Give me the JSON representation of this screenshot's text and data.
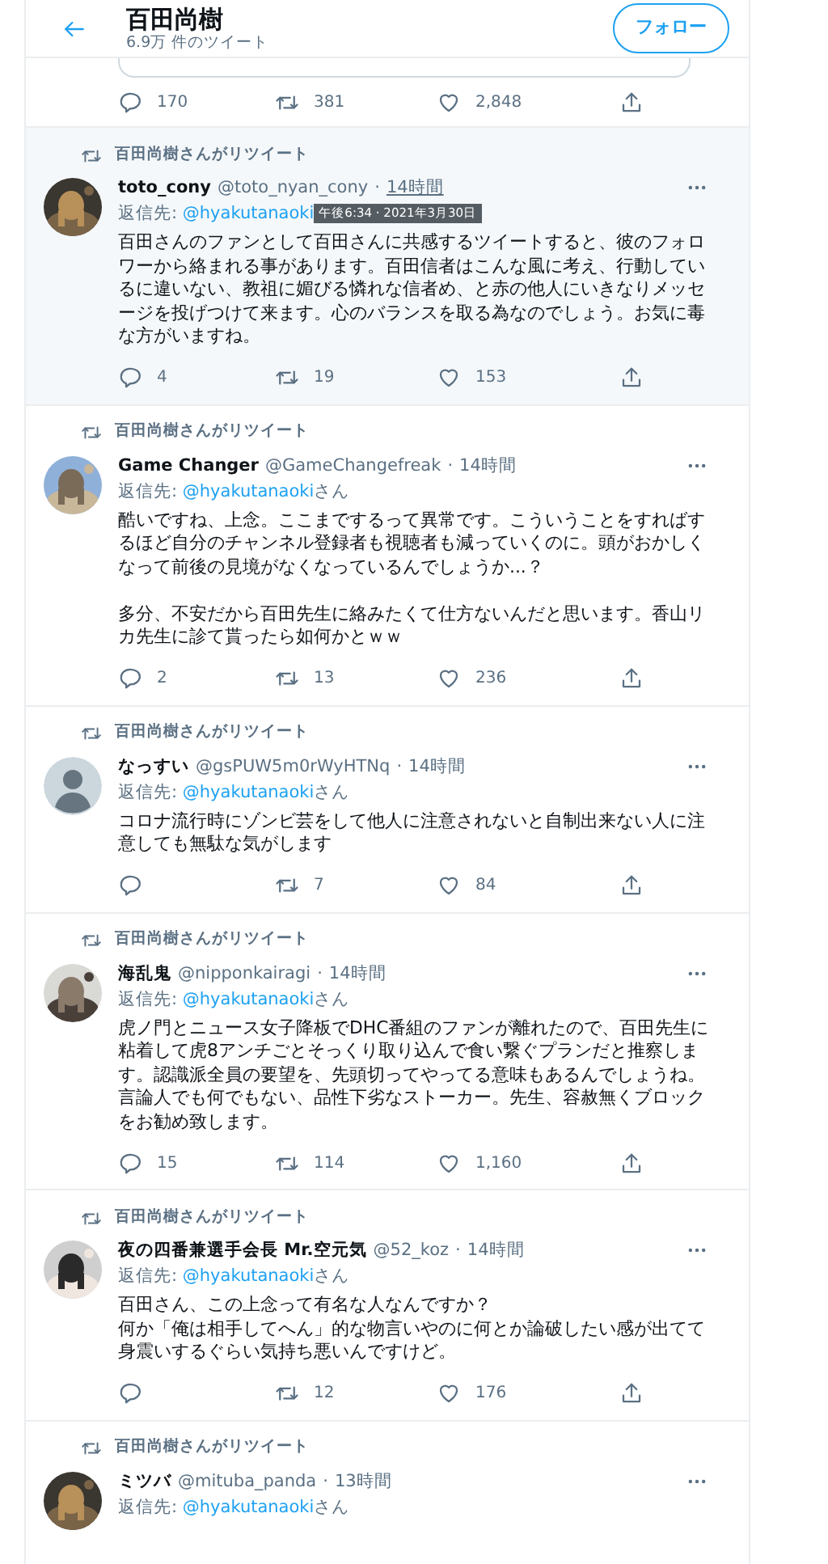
{
  "header": {
    "title": "百田尚樹",
    "subtitle": "6.9万 件のツイート",
    "follow_button": "フォロー"
  },
  "top_actions": {
    "reply": "170",
    "retweet": "381",
    "like": "2,848"
  },
  "tweets": [
    {
      "retweeted_by": "百田尚樹さんがリツイート",
      "avatar": {
        "kind": "picture"
      },
      "name": "toto_cony",
      "handle": "@toto_nyan_cony",
      "separator": "·",
      "time": "14時間",
      "hovered": true,
      "tooltip": "午後6:34 · 2021年3月30日",
      "reply_label": "返信先:",
      "reply_to": "@hyakutanaoki",
      "body": [
        [
          "百田さんのファンとして百田さんに共感するツイートすると、彼のフォロワーから絡まれる事があります。百田信者はこんな風に考え、行動しているに違いない、教祖に媚びる憐れな信者め、と赤の他人にいきなりメッセージを投げつけて来ます。心のバランスを取る為なのでしょう。お気に毒な方がいますね。"
        ]
      ],
      "reply": "4",
      "retweet": "19",
      "like": "153"
    },
    {
      "retweeted_by": "百田尚樹さんがリツイート",
      "avatar": {
        "kind": "picture"
      },
      "name": "Game Changer",
      "handle": "@GameChangefreak",
      "separator": "·",
      "time": "14時間",
      "hovered": false,
      "reply_label": "返信先:",
      "reply_to": "@hyakutanaoki",
      "reply_suffix": "さん",
      "body": [
        [
          "酷いですね、上念。ここまでするって異常です。こういうことをすればするほど自分のチャンネル登録者も視聴者も減っていくのに。頭がおかしくなって前後の見境がなくなっているんでしょうか...？"
        ],
        [
          "多分、不安だから百田先生に絡みたくて仕方ないんだと思います。香山リカ先生に診て貰ったら如何かとｗｗ"
        ]
      ],
      "reply": "2",
      "retweet": "13",
      "like": "236"
    },
    {
      "retweeted_by": "百田尚樹さんがリツイート",
      "avatar": {
        "kind": "default"
      },
      "name": "なっすい",
      "handle": "@gsPUW5m0rWyHTNq",
      "separator": "·",
      "time": "14時間",
      "hovered": false,
      "reply_label": "返信先:",
      "reply_to": "@hyakutanaoki",
      "reply_suffix": "さん",
      "body": [
        [
          "コロナ流行時にゾンビ芸をして他人に注意されないと自制出来ない人に注意しても無駄な気がします"
        ]
      ],
      "retweet": "7",
      "like": "84"
    },
    {
      "retweeted_by": "百田尚樹さんがリツイート",
      "avatar": {
        "kind": "picture"
      },
      "name": "海乱鬼",
      "handle": "@nipponkairagi",
      "separator": "·",
      "time": "14時間",
      "hovered": false,
      "reply_label": "返信先:",
      "reply_to": "@hyakutanaoki",
      "reply_suffix": "さん",
      "body": [
        [
          "虎ノ門とニュース女子降板でDHC番組のファンが離れたので、百田先生に粘着して虎8アンチごとそっくり取り込んで食い繋ぐプランだと推察します。認識派全員の要望を、先頭切ってやってる意味もあるんでしょうね。言論人でも何でもない、品性下劣なストーカー。先生、容赦無くブロックをお勧め致します。"
        ]
      ],
      "reply": "15",
      "retweet": "114",
      "like": "1,160"
    },
    {
      "retweeted_by": "百田尚樹さんがリツイート",
      "avatar": {
        "kind": "picture"
      },
      "name": "夜の四番兼選手会長 Mr.空元気",
      "handle": "@52_koz",
      "separator": "·",
      "time": "14時間",
      "hovered": false,
      "reply_label": "返信先:",
      "reply_to": "@hyakutanaoki",
      "reply_suffix": "さん",
      "body": [
        [
          "百田さん、この上念って有名な人なんですか？",
          "何か「俺は相手してへん」的な物言いやのに何とか論破したい感が出てて身震いするぐらい気持ち悪いんですけど。"
        ]
      ],
      "retweet": "12",
      "like": "176"
    },
    {
      "retweeted_by": "百田尚樹さんがリツイート",
      "avatar": {
        "kind": "picture"
      },
      "name": "ミツバ",
      "handle": "@mituba_panda",
      "separator": "·",
      "time": "13時間",
      "hovered": false,
      "reply_label": "返信先:",
      "reply_to": "@hyakutanaoki",
      "reply_suffix": "さん"
    }
  ]
}
